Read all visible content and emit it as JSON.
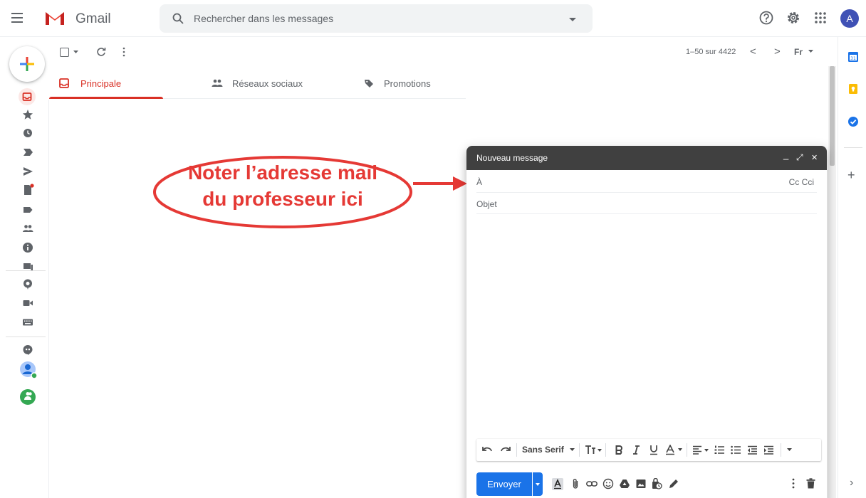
{
  "header": {
    "app_name": "Gmail",
    "search_placeholder": "Rechercher dans les messages",
    "account_initial": "A"
  },
  "toolbar": {
    "pager_text": "1–50 sur 4422",
    "prev_glyph": "<",
    "next_glyph": ">",
    "input_tool": "Fr"
  },
  "tabs": [
    {
      "label": "Principale",
      "active": true,
      "icon": "inbox-icon"
    },
    {
      "label": "Réseaux sociaux",
      "active": false,
      "icon": "people-icon"
    },
    {
      "label": "Promotions",
      "active": false,
      "icon": "tag-icon"
    }
  ],
  "annotation": {
    "line1": "Noter l’adresse mail",
    "line2": "du professeur ici",
    "color": "#e53935"
  },
  "compose": {
    "title": "Nouveau message",
    "minimize": "_",
    "expand": "⤢",
    "close": "✕",
    "to_label": "À",
    "cc_label": "Cc Cci",
    "subject_placeholder": "Objet",
    "font_name": "Sans Serif",
    "send_label": "Envoyer"
  },
  "colors": {
    "brand_red": "#d93025",
    "send_blue": "#1a73e8",
    "compose_header": "#404040"
  }
}
